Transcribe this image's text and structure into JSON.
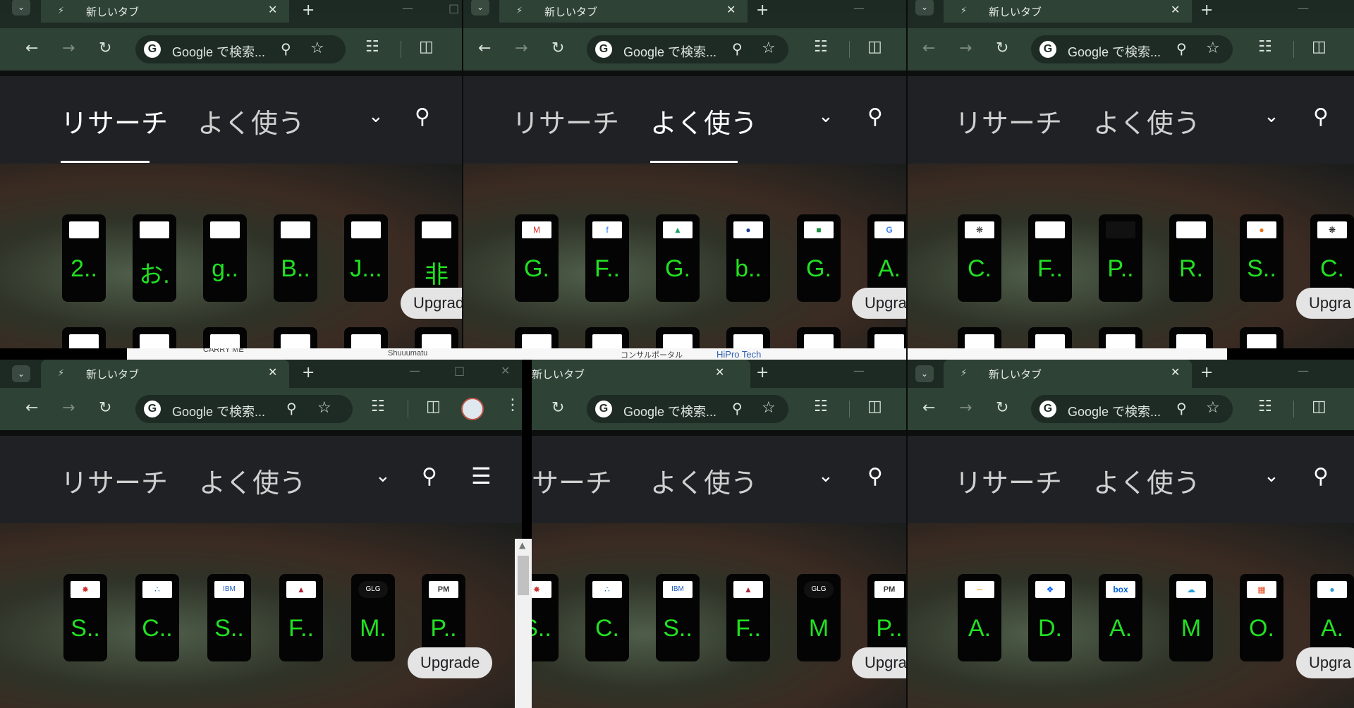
{
  "browser": {
    "tab_title": "新しいタブ",
    "omnibox_text": "Google で検索...",
    "new_tab_symbol": "+",
    "close_symbol": "✕"
  },
  "nav": {
    "research": "リサーチ",
    "frequent": "よく使う",
    "frequent_only_partial": "サーチ"
  },
  "upgrade": {
    "full": "Upgrade",
    "cut": "Upgra",
    "cut2": "Upgrad"
  },
  "windows": [
    {
      "tiles": [
        "2..",
        "お.",
        "g..",
        "B..",
        "J...",
        "非"
      ],
      "icons": [
        "thumbnail-icon",
        "thumbnail-icon",
        "thumbnail-icon",
        "thumbnail-icon",
        "thumbnail-icon",
        "thumbnail-icon"
      ]
    },
    {
      "tiles": [
        "G.",
        "F..",
        "G.",
        "b..",
        "G.",
        "A."
      ],
      "icons": [
        "gmail-icon",
        "facebook-icon",
        "google-drive-icon",
        "thumbnail-icon",
        "google-classroom-icon",
        "google-icon"
      ]
    },
    {
      "tiles": [
        "C.",
        "F..",
        "P..",
        "R.",
        "S..",
        "C."
      ],
      "icons": [
        "openai-icon",
        "thumbnail-icon",
        "thumbnail-icon",
        "thumbnail-icon",
        "thumbnail-icon",
        "thumbnail-icon"
      ]
    },
    {
      "tiles": [
        "S..",
        "C..",
        "S..",
        "F..",
        "M.",
        "P.."
      ],
      "icons": [
        "thumbnail-icon",
        "thumbnail-icon",
        "ibm-icon",
        "thumbnail-icon",
        "glg-icon",
        "pm-icon"
      ]
    },
    {
      "tiles": [
        "S..",
        "C.",
        "S..",
        "F..",
        "M",
        "P.."
      ],
      "icons": [
        "thumbnail-icon",
        "thumbnail-icon",
        "ibm-icon",
        "thumbnail-icon",
        "glg-icon",
        "pm-icon"
      ]
    },
    {
      "tiles": [
        "A.",
        "D.",
        "A.",
        "M",
        "O.",
        "A."
      ],
      "icons": [
        "amazon-icon",
        "dropbox-icon",
        "box-icon",
        "cloud-icon",
        "office-icon",
        "thumbnail-icon"
      ]
    }
  ],
  "icon_text": {
    "ibm": "IBM",
    "glg": "GLG",
    "pm": "PM",
    "box": "box"
  },
  "background_strip": {
    "carry": "CARRY ME",
    "shuu": "Shuuumatu",
    "consul": "コンサルポータル",
    "hipro": "HiPro Tech"
  }
}
